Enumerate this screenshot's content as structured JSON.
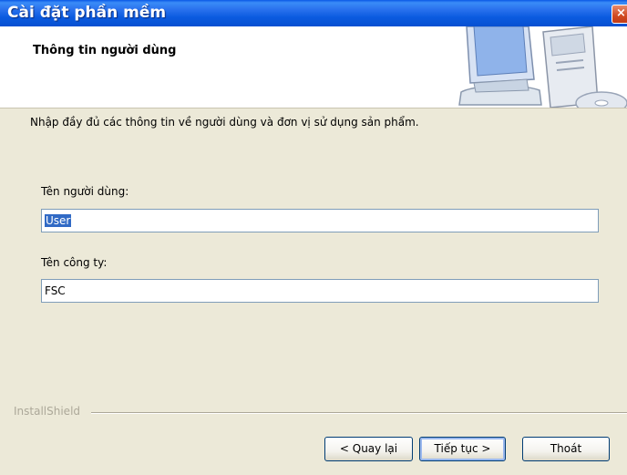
{
  "window": {
    "title": "Cài đặt phần mềm",
    "close_label": "×"
  },
  "header": {
    "title": "Thông tin người dùng"
  },
  "content": {
    "instruction": "Nhập đầy đủ các thông tin về người dùng và đơn vị sử dụng sản phẩm.",
    "user_name_label": "Tên người dùng:",
    "user_name_value": "User",
    "company_label": "Tên công ty:",
    "company_value": "FSC"
  },
  "footer": {
    "brand": "InstallShield",
    "back_label": "< Quay lại",
    "next_label": "Tiếp tục >",
    "exit_label": "Thoát"
  },
  "colors": {
    "titlebar": "#0a58e6",
    "selection": "#316ac5",
    "dialog_bg": "#ece9d8"
  }
}
